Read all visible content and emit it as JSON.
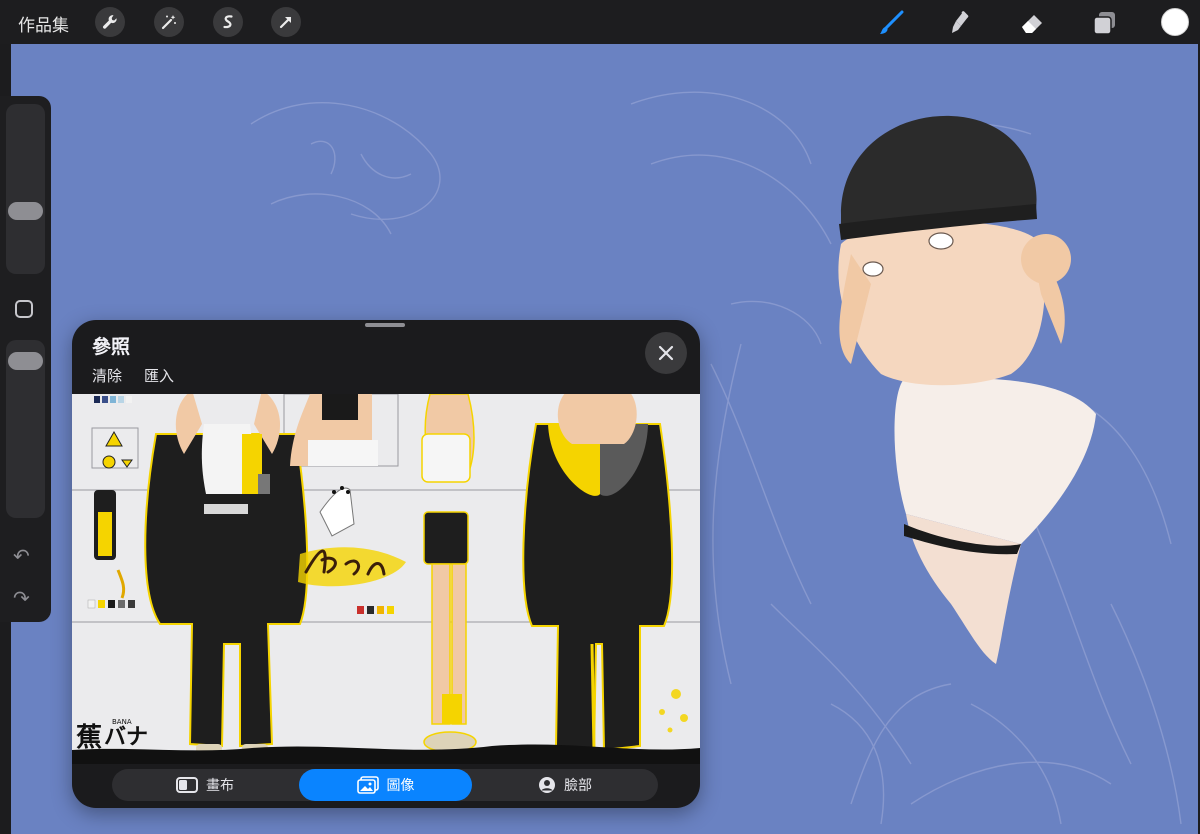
{
  "topbar": {
    "gallery_label": "作品集",
    "left_tools": [
      "wrench-icon",
      "magic-wand-icon",
      "selection-icon",
      "transform-arrow-icon"
    ],
    "right_tools": [
      "brush-icon",
      "smudge-icon",
      "eraser-icon",
      "layers-icon"
    ],
    "active_tool": "brush",
    "color": "#ffffff",
    "accent": "#0a84ff"
  },
  "sidebar": {
    "brush_size_level": 0.5,
    "opacity_level": 0.9,
    "icons": [
      "modify-square-icon",
      "undo-icon",
      "redo-icon"
    ]
  },
  "canvas": {
    "background": "#6a82c2"
  },
  "reference": {
    "title": "參照",
    "actions": {
      "clear": "清除",
      "import": "匯入"
    },
    "tabs": [
      {
        "label": "畫布",
        "icon": "canvas-icon",
        "selected": false
      },
      {
        "label": "圖像",
        "icon": "image-icon",
        "selected": true
      },
      {
        "label": "臉部",
        "icon": "face-icon",
        "selected": false
      }
    ],
    "image_logo": {
      "kanji": "蕉",
      "kana": "バナ",
      "latin": "BANA"
    },
    "image_signature": "Bana"
  }
}
